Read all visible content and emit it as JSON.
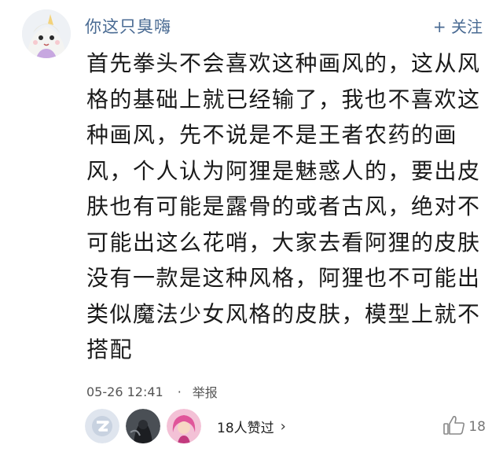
{
  "user": {
    "name": "你这只臭嗨",
    "follow_label": "+ 关注"
  },
  "post": {
    "lines": [
      "首先拳头不会喜欢这种画风的，这从风",
      "格的基础上就已经输了，我也不喜欢这",
      "种画风，先不说是不是王者农药的画",
      "风，个人认为阿狸是魅惑人的，要出皮",
      "肤也有可能是露骨的或者古风，绝对不",
      "可能出这么花哨，大家去看阿狸的皮肤",
      "没有一款是这种风格，阿狸也不可能出",
      "类似魔法少女风格的皮肤，模型上就不",
      "搭配"
    ]
  },
  "meta": {
    "timestamp": "05-26 12:41",
    "separator": "·",
    "report_label": "举报"
  },
  "likes": {
    "summary": "18人赞过",
    "chevron": "›",
    "count": "18"
  },
  "icons": {
    "like": "thumbs-up-icon",
    "chevron": "chevron-right-icon"
  },
  "colors": {
    "username": "#4a6b93",
    "text": "#1a1a1a",
    "meta": "#555555"
  }
}
